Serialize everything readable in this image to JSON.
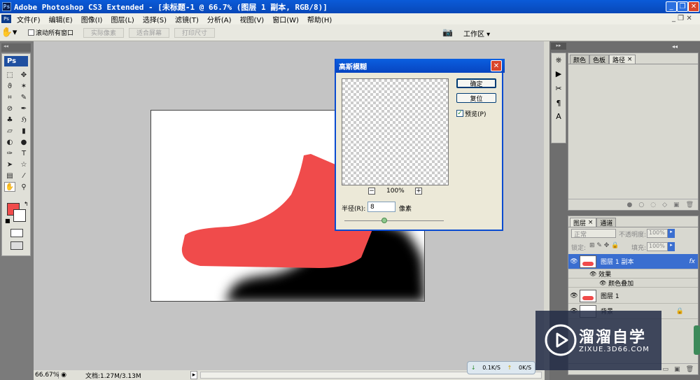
{
  "window": {
    "title": "Adobe Photoshop CS3 Extended - [未标题-1 @ 66.7% (图层 1 副本, RGB/8)]",
    "app_icon": "Ps"
  },
  "menu": [
    "文件(F)",
    "编辑(E)",
    "图像(I)",
    "图层(L)",
    "选择(S)",
    "滤镜(T)",
    "分析(A)",
    "视图(V)",
    "窗口(W)",
    "帮助(H)"
  ],
  "options": {
    "scroll_all_label": "滚动所有窗口",
    "actual_pixels": "实际像素",
    "fit_screen": "适合屏幕",
    "print_size": "打印尺寸",
    "workspace": "工作区 ▾"
  },
  "toolbox": {
    "logo": "Ps",
    "foreground_color": "#f04b4b",
    "background_color": "#ffffff"
  },
  "canvas": {
    "shape_color": "#f04b4b"
  },
  "dialog": {
    "title": "高斯模糊",
    "ok_label": "确定",
    "reset_label": "复位",
    "preview_checkbox_label": "预览(P)",
    "preview_checked": true,
    "zoom_minus": "−",
    "zoom_plus": "+",
    "zoom_level": "100%",
    "radius_label": "半径(R):",
    "radius_value": "8",
    "radius_unit": "像素",
    "slider_position": 0.4
  },
  "panel_top": {
    "tabs": [
      "颜色",
      "色板",
      "路径"
    ]
  },
  "panel_layers": {
    "tabs": [
      "图层",
      "通道"
    ],
    "blend_mode": "正常",
    "opacity_label": "不透明度:",
    "opacity_value": "100%",
    "lock_label": "锁定:",
    "fill_label": "填充:",
    "fill_value": "100%",
    "layers": [
      {
        "name": "图层 1 副本",
        "selected": true,
        "fx": "fx"
      },
      {
        "name": "效果",
        "sub": true
      },
      {
        "name": "颜色叠加",
        "sub": true
      },
      {
        "name": "图层 1",
        "selected": false
      },
      {
        "name": "背景",
        "selected": false
      }
    ]
  },
  "status": {
    "zoom": "66.67%",
    "doc_info": "文档:1.27M/3.13M"
  },
  "network": {
    "upload": "0.1K/S",
    "download": "0K/S"
  },
  "watermark": {
    "brand": "溜溜自学",
    "url": "ZIXUE.3D66.COM"
  }
}
